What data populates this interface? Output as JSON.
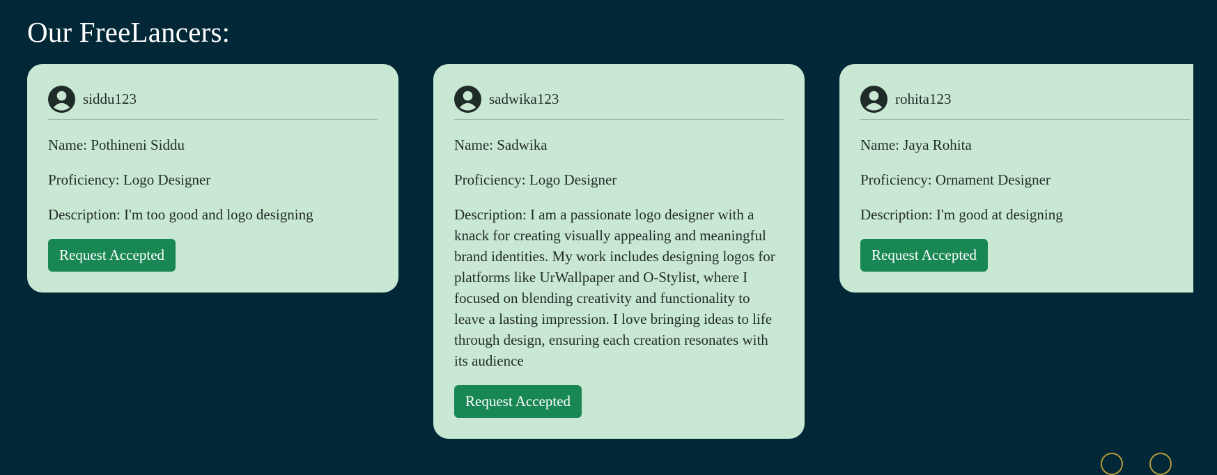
{
  "page": {
    "heading": "Our FreeLancers:"
  },
  "freelancers": [
    {
      "username": "siddu123",
      "name_line": "Name: Pothineni Siddu",
      "proficiency_line": "Proficiency: Logo Designer",
      "description_line": "Description: I'm too good and logo designing",
      "button_label": "Request Accepted"
    },
    {
      "username": "sadwika123",
      "name_line": "Name: Sadwika",
      "proficiency_line": "Proficiency: Logo Designer",
      "description_line": "Description: I am a passionate logo designer with a knack for creating visually appealing and meaningful brand identities. My work includes designing logos for platforms like UrWallpaper and O-Stylist, where I focused on blending creativity and functionality to leave a lasting impression. I love bringing ideas to life through design, ensuring each creation resonates with its audience",
      "button_label": "Request Accepted"
    },
    {
      "username": "rohita123",
      "name_line": "Name: Jaya Rohita",
      "proficiency_line": "Proficiency: Ornament Designer",
      "description_line": "Description: I'm good at designing",
      "button_label": "Request Accepted"
    }
  ],
  "colors": {
    "background": "#022838",
    "card": "#c9e8d3",
    "button": "#198754",
    "text": "#1f2b28"
  },
  "icons": {
    "avatar": "user-circle-icon"
  }
}
